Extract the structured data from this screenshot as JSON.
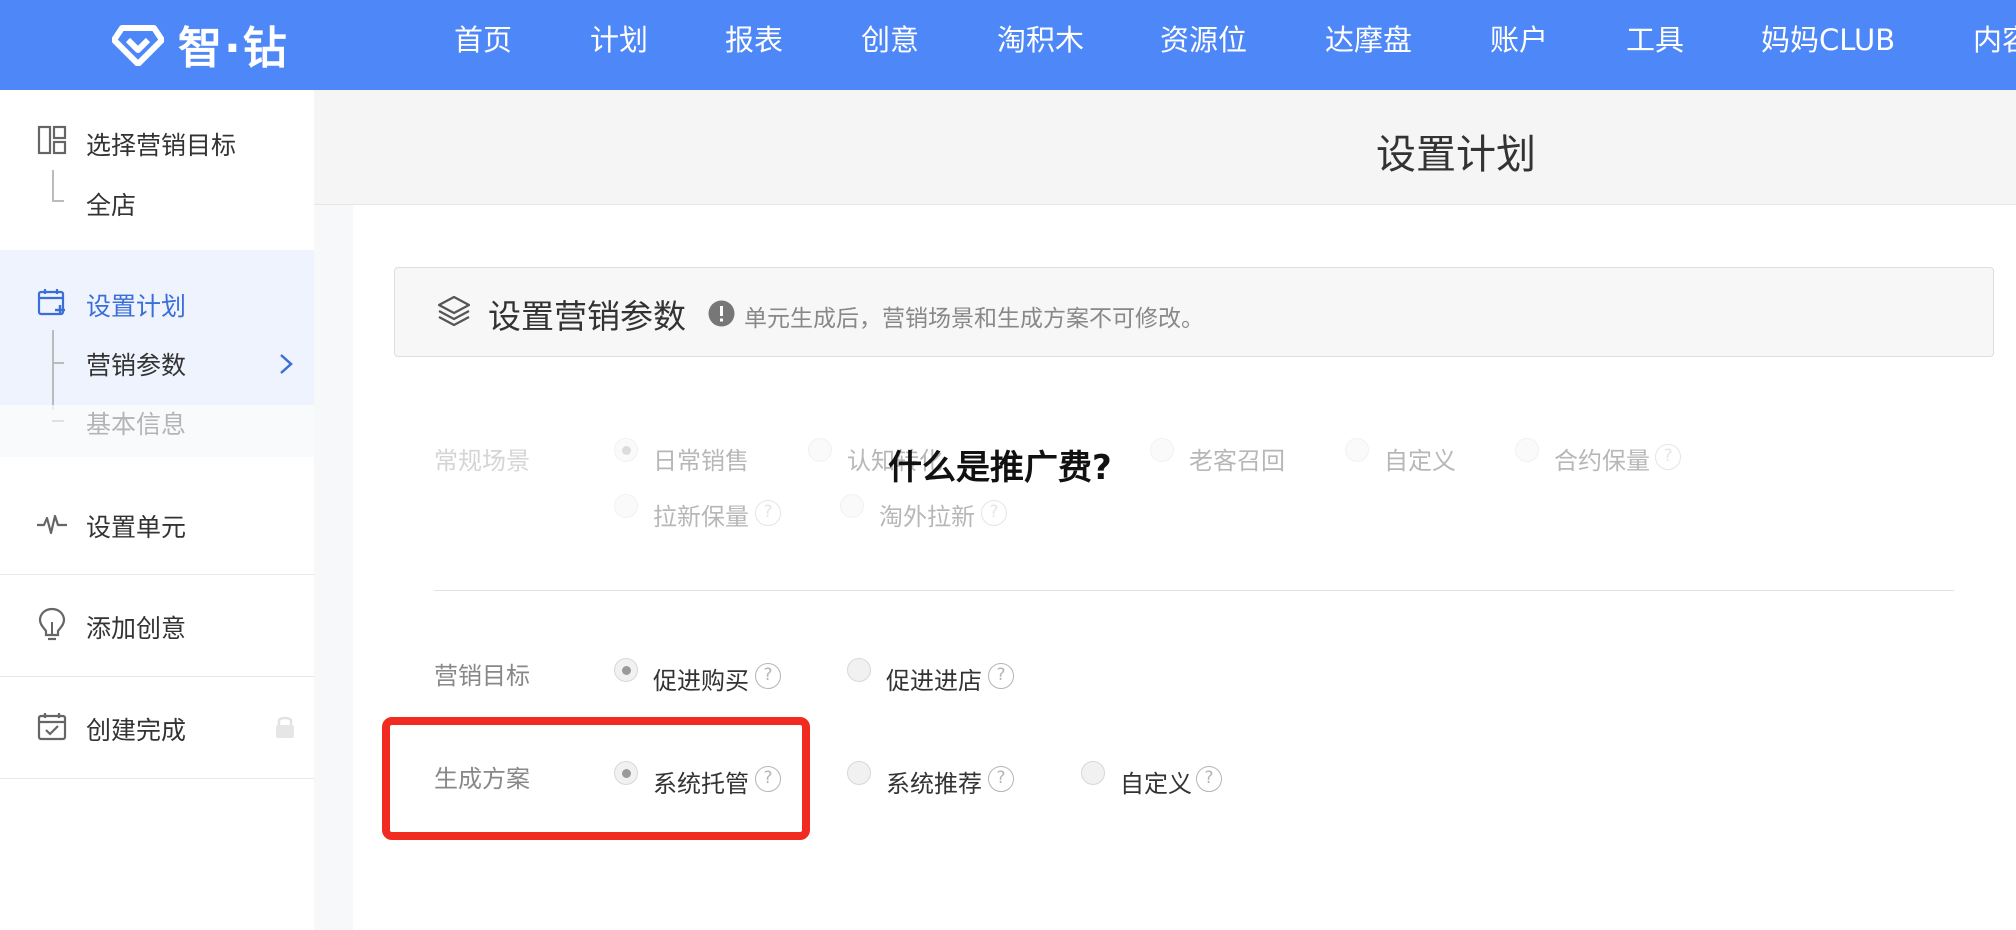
{
  "app": {
    "logo_text": "智·钻"
  },
  "nav": {
    "items": [
      "首页",
      "计划",
      "报表",
      "创意",
      "淘积木",
      "资源位",
      "达摩盘",
      "账户",
      "工具",
      "妈妈CLUB",
      "内容"
    ]
  },
  "sidebar": {
    "steps": [
      {
        "label": "选择营销目标",
        "icon": "layout-icon",
        "sub": [
          "全店"
        ]
      },
      {
        "label": "设置计划",
        "icon": "calendar-plus-icon",
        "active": true,
        "sub": [
          "营销参数",
          "基本信息"
        ]
      },
      {
        "label": "设置单元",
        "icon": "pulse-icon"
      },
      {
        "label": "添加创意",
        "icon": "lightbulb-icon"
      },
      {
        "label": "创建完成",
        "icon": "calendar-check-icon",
        "locked": true
      }
    ]
  },
  "page": {
    "title": "设置计划"
  },
  "panel": {
    "title": "设置营销参数",
    "note": "单元生成后，营销场景和生成方案不可修改。"
  },
  "form": {
    "scene": {
      "label": "常规场景",
      "options": [
        "日常销售",
        "认知转化",
        "老客召回",
        "自定义",
        "合约保量",
        "拉新保量",
        "淘外拉新"
      ],
      "selected": "日常销售"
    },
    "goal": {
      "label": "营销目标",
      "options": [
        "促进购买",
        "促进进店"
      ],
      "selected": "促进购买"
    },
    "plan": {
      "label": "生成方案",
      "options": [
        "系统托管",
        "系统推荐",
        "自定义"
      ],
      "selected": "系统托管"
    }
  },
  "overlay": {
    "question": "什么是推广费?"
  },
  "colors": {
    "topbar": "#4e87f7",
    "active_side": "#3a6fd8",
    "highlight": "#f22b20"
  }
}
